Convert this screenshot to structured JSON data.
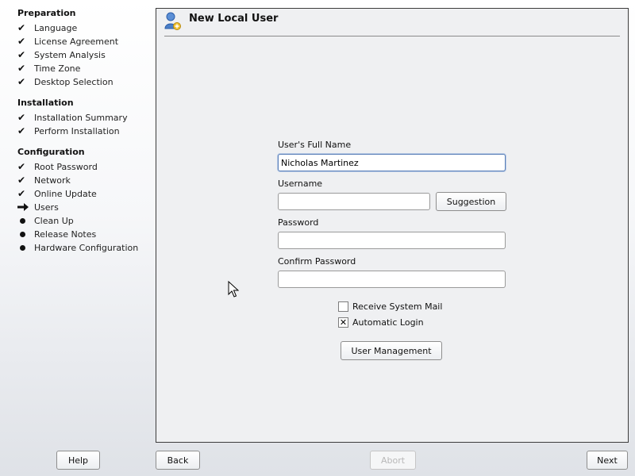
{
  "sidebar": {
    "sections": [
      {
        "title": "Preparation",
        "steps": [
          {
            "label": "Language",
            "status": "done"
          },
          {
            "label": "License Agreement",
            "status": "done"
          },
          {
            "label": "System Analysis",
            "status": "done"
          },
          {
            "label": "Time Zone",
            "status": "done"
          },
          {
            "label": "Desktop Selection",
            "status": "done"
          }
        ]
      },
      {
        "title": "Installation",
        "steps": [
          {
            "label": "Installation Summary",
            "status": "done"
          },
          {
            "label": "Perform Installation",
            "status": "done"
          }
        ]
      },
      {
        "title": "Configuration",
        "steps": [
          {
            "label": "Root Password",
            "status": "done"
          },
          {
            "label": "Network",
            "status": "done"
          },
          {
            "label": "Online Update",
            "status": "done"
          },
          {
            "label": "Users",
            "status": "current"
          },
          {
            "label": "Clean Up",
            "status": "pending"
          },
          {
            "label": "Release Notes",
            "status": "pending"
          },
          {
            "label": "Hardware Configuration",
            "status": "pending"
          }
        ]
      }
    ],
    "icons": {
      "done": "checkmark-icon",
      "current": "arrow-right-icon",
      "pending": "bullet-icon"
    }
  },
  "main": {
    "title": "New Local User",
    "title_icon": "user-icon",
    "fields": {
      "full_name": {
        "label": "User's Full Name",
        "value": "Nicholas Martinez"
      },
      "username": {
        "label": "Username",
        "value": ""
      },
      "password": {
        "label": "Password",
        "value": ""
      },
      "confirm_password": {
        "label": "Confirm Password",
        "value": ""
      }
    },
    "suggestion_button": "Suggestion",
    "receive_system_mail": {
      "label": "Receive System Mail",
      "checked": false
    },
    "automatic_login": {
      "label": "Automatic Login",
      "checked": true
    },
    "user_management_button": "User Management"
  },
  "footer": {
    "help": "Help",
    "back": "Back",
    "abort": "Abort",
    "next": "Next"
  }
}
